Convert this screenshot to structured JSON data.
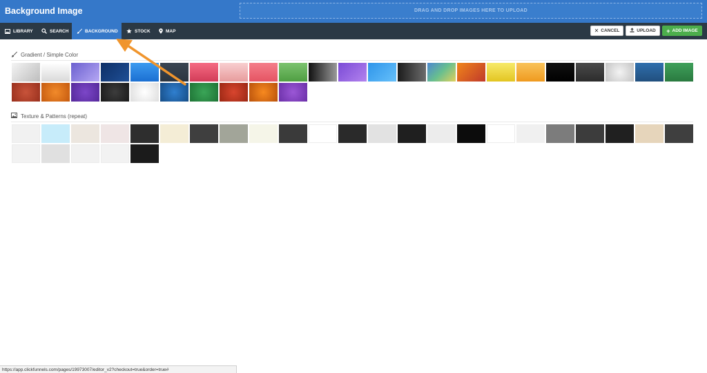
{
  "header": {
    "title": "Background Image",
    "dropzone_text": "DRAG AND DROP IMAGES HERE TO UPLOAD"
  },
  "tabs": [
    {
      "label": "LIBRARY",
      "icon": "image-icon",
      "active": false
    },
    {
      "label": "SEARCH",
      "icon": "search-icon",
      "active": false
    },
    {
      "label": "BACKGROUND",
      "icon": "paintbrush-icon",
      "active": true
    },
    {
      "label": "STOCK",
      "icon": "star-icon",
      "active": false
    },
    {
      "label": "MAP",
      "icon": "map-pin-icon",
      "active": false
    }
  ],
  "actions": {
    "cancel": "CANCEL",
    "upload": "UPLOAD",
    "add_image": "ADD IMAGE"
  },
  "sections": {
    "gradient": {
      "title": "Gradient / Simple Color",
      "icon": "paintbrush-icon",
      "swatches": [
        "linear-gradient(135deg,#f4f4f4,#bdbdbd)",
        "linear-gradient(180deg,#ffffff,#d9d9d9)",
        "linear-gradient(135deg,#6a5fcf,#b6a8f4)",
        "linear-gradient(135deg,#0d2f66,#1f4f96)",
        "linear-gradient(180deg,#3c9bf0,#1b6fd2)",
        "linear-gradient(180deg,#3a4552,#2b3540)",
        "linear-gradient(180deg,#f56b83,#d23c58)",
        "linear-gradient(180deg,#f8cfd0,#e79b9c)",
        "linear-gradient(180deg,#f47e8a,#e55463)",
        "linear-gradient(180deg,#7cc36f,#4f9e42)",
        "linear-gradient(90deg,#111111,#9a9a9a)",
        "linear-gradient(135deg,#7a4ad6,#b383ee)",
        "linear-gradient(135deg,#2e95ea,#66c0fa)",
        "linear-gradient(90deg,#1c1c1c,#6c6c6c)",
        "linear-gradient(135deg,#4c87d0,#68bf8f,#e0d05c)",
        "linear-gradient(135deg,#f0851a,#c0392b)",
        "linear-gradient(180deg,#f7ea6a,#e3c521)",
        "linear-gradient(180deg,#f9c35a,#ef9a1f)",
        "linear-gradient(180deg,#111,#000)",
        "linear-gradient(180deg,#4a4a4a,#2c2c2c)",
        "radial-gradient(circle,#f3f3f3,#c4c4c4)",
        "linear-gradient(180deg,#2f6fad,#214f7e)",
        "linear-gradient(180deg,#3fa05b,#2a7a40)",
        "radial-gradient(circle,#c8533a,#99301d)",
        "radial-gradient(circle,#f18a2a,#c55a0f)",
        "radial-gradient(circle,#7c46c8,#55299a)",
        "radial-gradient(circle,#3c3c3c,#1a1a1a)",
        "radial-gradient(circle,#ffffff,#dedede)",
        "radial-gradient(circle,#2f7fcf,#174d86)",
        "radial-gradient(circle,#3aa557,#1f7436)",
        "radial-gradient(circle,#d8452e,#9a2814)",
        "radial-gradient(circle,#f7891f,#b9520c)",
        "radial-gradient(circle,#9b57d6,#6b30a8)"
      ]
    },
    "texture": {
      "title": "Texture & Patterns (repeat)",
      "icon": "picture-icon",
      "swatches": [
        "#f1f1f1",
        "#c7ecfa",
        "#ece6df",
        "#efe5e5",
        "#2e2e2e",
        "#f4edd6",
        "#3f3f3f",
        "#a2a599",
        "#f5f5e8",
        "#3a3a3a",
        "#ffffff",
        "#2a2a2a",
        "#e2e2e2",
        "#1f1f1f",
        "#ececec",
        "#0c0c0c",
        "#ffffff",
        "#f0f0f0",
        "#7c7c7c",
        "#3c3c3c",
        "#202020",
        "#e6d5bb",
        "#3f3f3f",
        "#f2f2f2",
        "#e0e0e0",
        "#f1f1f1",
        "#f2f2f2",
        "#1b1b1b"
      ]
    }
  },
  "status_url": "https://app.clickfunnels.com/pages/19973007/editor_v2?checkout=true&order=true#",
  "colors": {
    "header_blue": "#3578c9",
    "toolbar_dark": "#2b3945",
    "add_green": "#4cae4c",
    "arrow_orange": "#f0952d"
  }
}
